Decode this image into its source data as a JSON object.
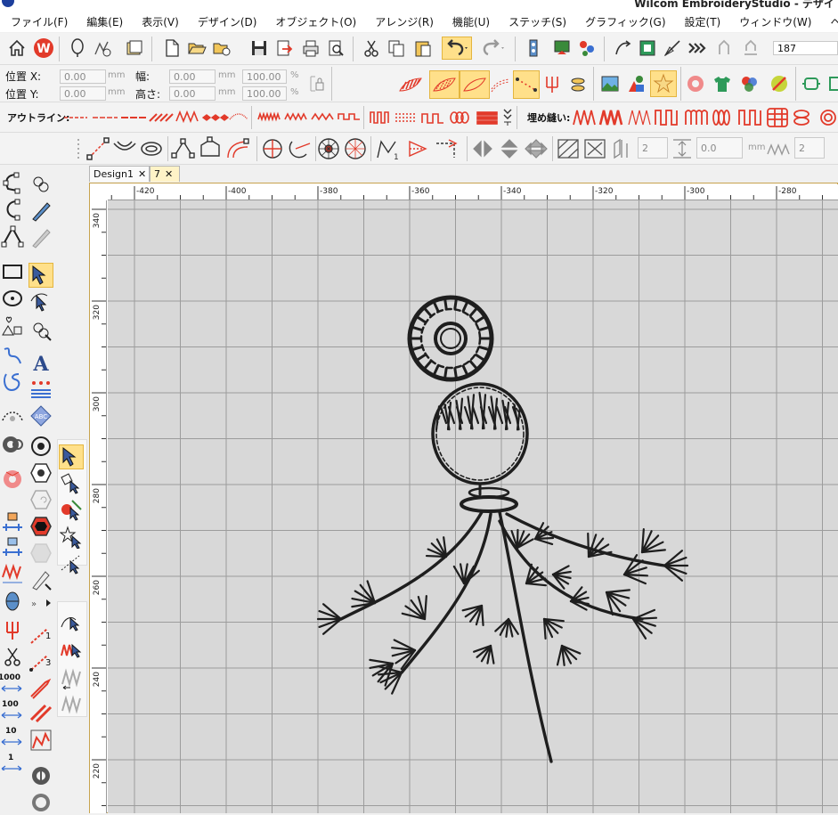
{
  "window": {
    "title": "Wilcom EmbroideryStudio - デザイ"
  },
  "menu": [
    "ファイル(F)",
    "編集(E)",
    "表示(V)",
    "デザイン(D)",
    "オブジェクト(O)",
    "アレンジ(R)",
    "機能(U)",
    "ステッチ(S)",
    "グラフィック(G)",
    "設定(T)",
    "ウィンドウ(W)",
    "ヘルプ(H)"
  ],
  "toolbar": {
    "zoom_value": "187"
  },
  "props": {
    "pos_x_label": "位置 X:",
    "pos_y_label": "位置 Y:",
    "width_label": "幅:",
    "height_label": "高さ:",
    "pos_x": "0.00",
    "pos_y": "0.00",
    "width": "0.00",
    "height": "0.00",
    "scale_x": "100.00",
    "scale_y": "100.00",
    "unit_mm": "mm",
    "unit_pct": "%"
  },
  "stitch_bar": {
    "outline_label": "アウトライン:",
    "fill_label": "埋め縫い:"
  },
  "edit_bar": {
    "value_a": "2",
    "value_b": "0.0",
    "unit": "mm",
    "value_c": "2"
  },
  "left_labels": {
    "one": "1",
    "three": "3",
    "v1000": "1000",
    "v100": "100",
    "v10": "10",
    "v1": "1"
  },
  "tabs": [
    {
      "label": "Design1",
      "close": "✕"
    },
    {
      "label": "7",
      "close": "✕"
    }
  ],
  "ruler": {
    "h_labels": [
      "-420",
      "-400",
      "-380",
      "-360",
      "-340",
      "-320",
      "-300",
      "-280"
    ],
    "v_labels": [
      "340",
      "320",
      "300",
      "280",
      "260",
      "240",
      "220"
    ]
  },
  "colors": {
    "accent": "#e23a2a",
    "highlight": "#ffe08a",
    "canvas": "#d8d8d8",
    "grid": "#9c9c9c",
    "stitch": "#1e1e1e"
  }
}
